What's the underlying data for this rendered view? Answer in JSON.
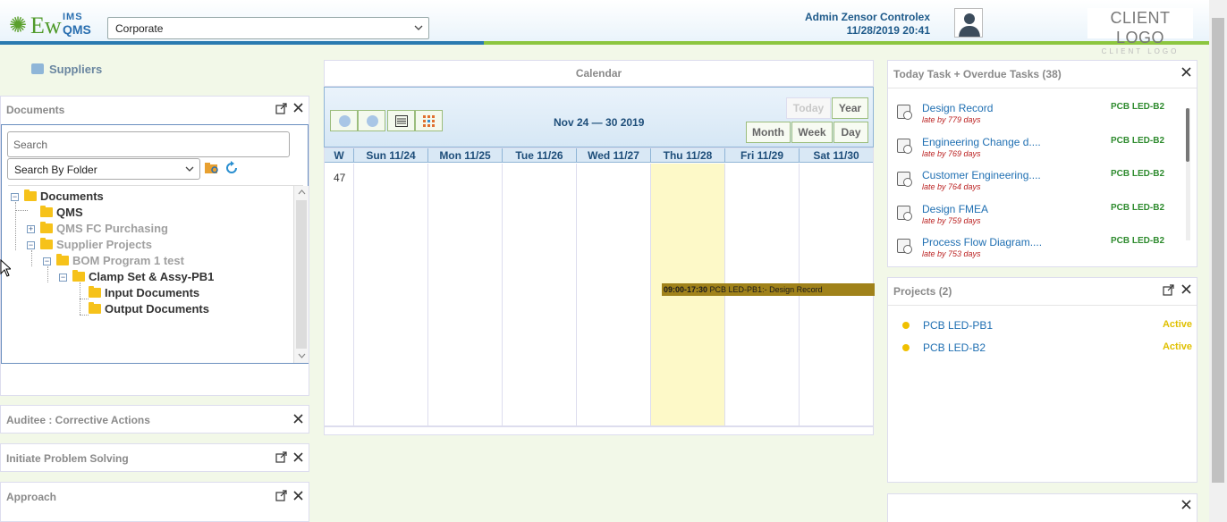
{
  "header": {
    "logo_ew": "Ew",
    "logo_ims": "IMS",
    "logo_qms": "QMS",
    "org_selected": "Corporate",
    "user_name": "Admin Zensor Controlex",
    "user_datetime": "11/28/2019 20:41",
    "client_logo_big": "CLIENT LOGO",
    "client_logo_small": "CLIENT LOGO"
  },
  "left": {
    "suppliers_label": "Suppliers",
    "documents": {
      "title": "Documents",
      "search_placeholder": "Search",
      "folder_select": "Search By Folder",
      "tree": [
        {
          "label": "Documents",
          "toggle": "−"
        },
        {
          "label": "QMS",
          "toggle": ""
        },
        {
          "label": "QMS FC Purchasing",
          "toggle": "+"
        },
        {
          "label": "Supplier Projects",
          "toggle": "−"
        },
        {
          "label": "BOM Program 1 test",
          "toggle": "−"
        },
        {
          "label": "Clamp Set & Assy-PB1",
          "toggle": "−"
        },
        {
          "label": "Input Documents",
          "toggle": ""
        },
        {
          "label": "Output Documents",
          "toggle": ""
        }
      ]
    },
    "auditee_title": "Auditee : Corrective Actions",
    "initiate_title": "Initiate Problem Solving",
    "approach_title": "Approach"
  },
  "calendar": {
    "title": "Calendar",
    "range": "Nov 24 — 30 2019",
    "btn_today": "Today",
    "btn_year": "Year",
    "btn_month": "Month",
    "btn_week": "Week",
    "btn_day": "Day",
    "headers": [
      "W",
      "Sun 11/24",
      "Mon 11/25",
      "Tue 11/26",
      "Wed 11/27",
      "Thu 11/28",
      "Fri 11/29",
      "Sat 11/30"
    ],
    "week_number": "47",
    "event_time": "09:00-17:30",
    "event_text": " PCB LED-PB1:- Design Record"
  },
  "tasks": {
    "title": "Today Task + Overdue Tasks (38)",
    "items": [
      {
        "name": "Design Record",
        "late": "late by 779 days",
        "project": "PCB LED-B2"
      },
      {
        "name": "Engineering Change d....",
        "late": "late by 769 days",
        "project": "PCB LED-B2"
      },
      {
        "name": "Customer Engineering....",
        "late": "late by 764 days",
        "project": "PCB LED-B2"
      },
      {
        "name": "Design FMEA",
        "late": "late by 759 days",
        "project": "PCB LED-B2"
      },
      {
        "name": "Process Flow Diagram....",
        "late": "late by 753 days",
        "project": "PCB LED-B2"
      }
    ]
  },
  "projects": {
    "title": "Projects (2)",
    "items": [
      {
        "name": "PCB LED-PB1",
        "status": "Active"
      },
      {
        "name": "PCB LED-B2",
        "status": "Active"
      }
    ]
  },
  "colors": {
    "accent_green": "#8cc63f",
    "link_blue": "#1f6fb2",
    "today_yellow": "#fdf9c8",
    "event_gold": "#a0821a",
    "active_yellow": "#e0c000"
  }
}
